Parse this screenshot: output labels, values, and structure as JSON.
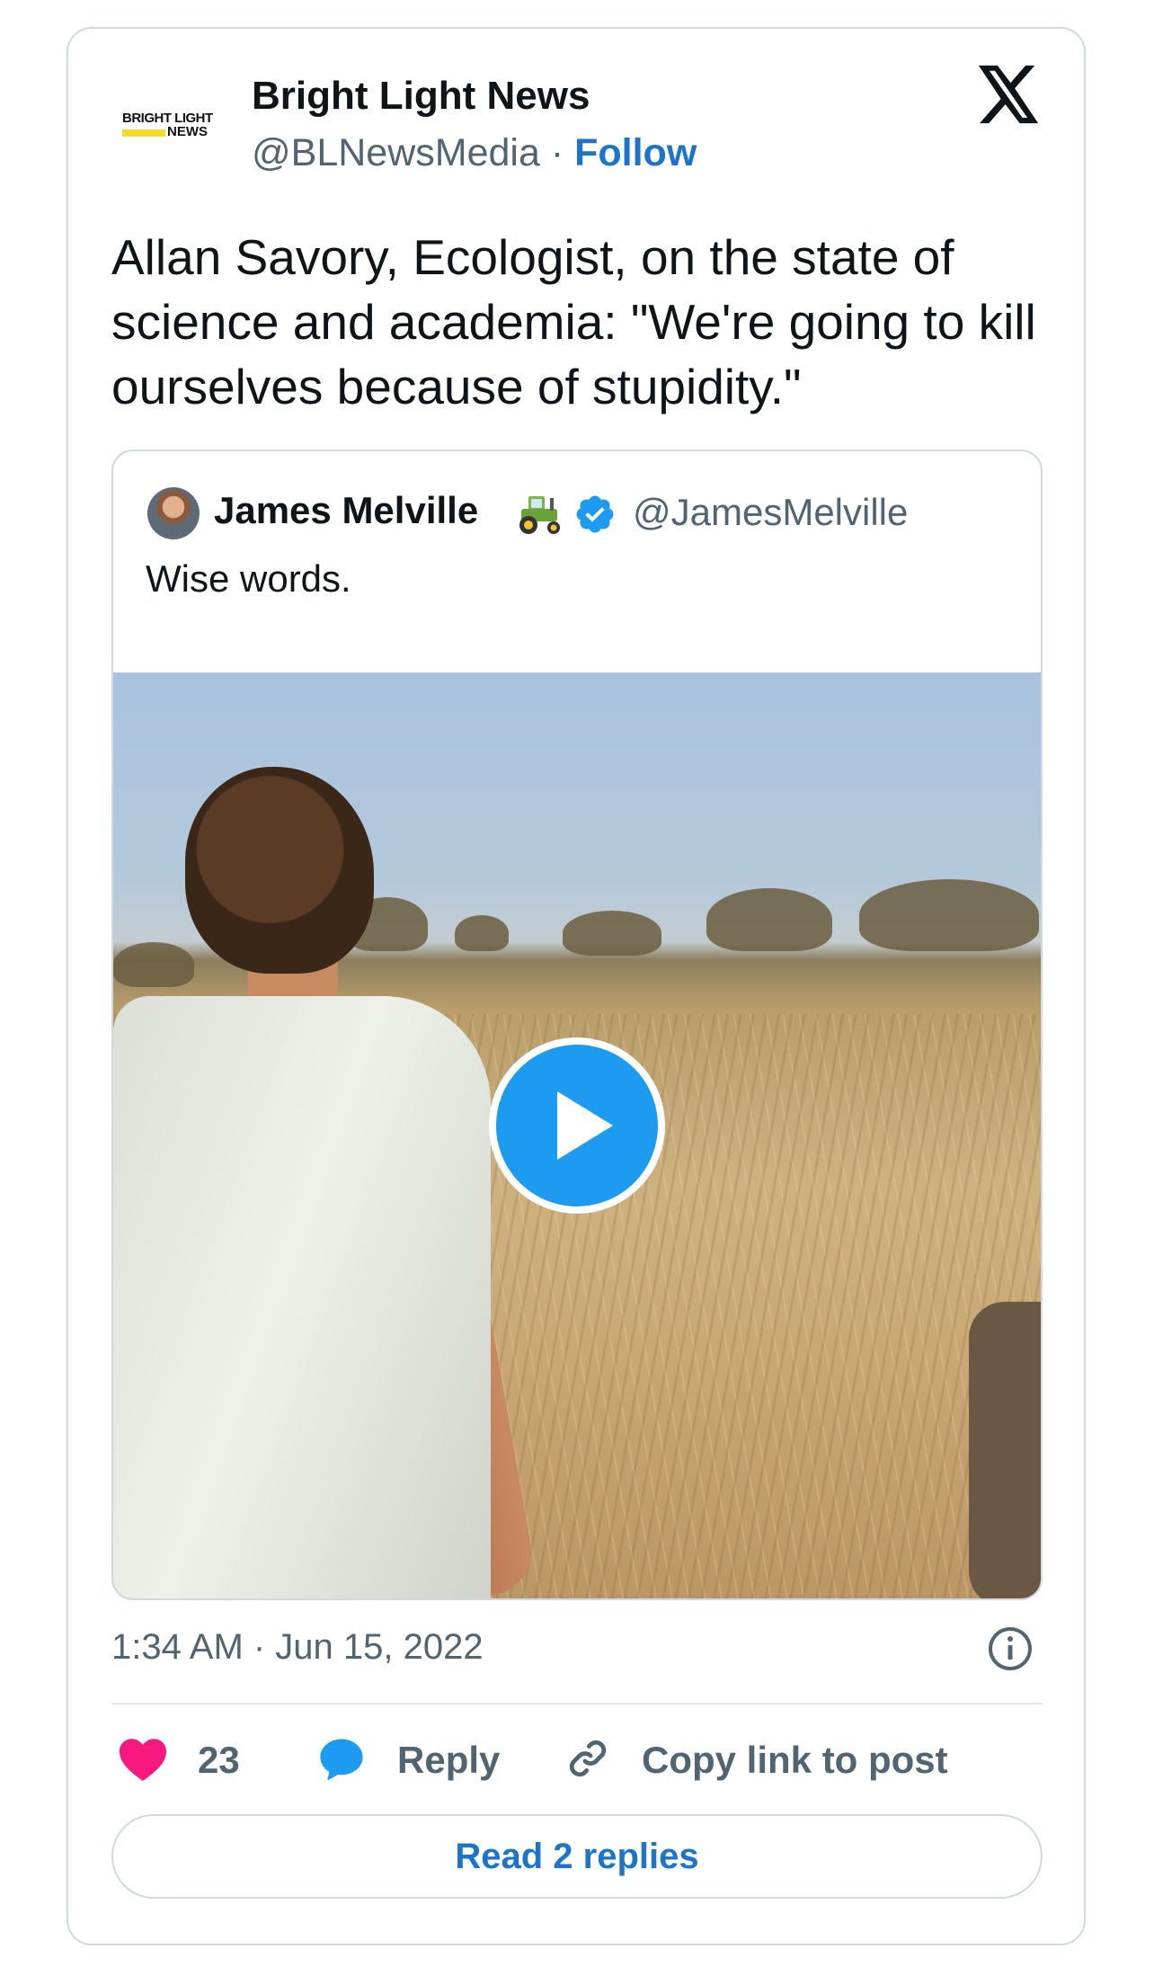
{
  "author": {
    "logo_text": "BRIGHT LIGHT",
    "logo_text2": "NEWS",
    "name": "Bright Light News",
    "handle": "@BLNewsMedia",
    "separator": "·",
    "follow_label": "Follow"
  },
  "tweet": {
    "text": "Allan Savory, Ecologist, on the state of science and academia: \"We're going to kill ourselves because of stupidity.\"",
    "timestamp": "1:34 AM · Jun 15, 2022"
  },
  "quoted": {
    "name": "James Melville",
    "handle": "@JamesMelville",
    "text": "Wise words."
  },
  "actions": {
    "likes_count": "23",
    "reply_label": "Reply",
    "copy_link_label": "Copy link to post",
    "read_replies_label": "Read 2 replies"
  },
  "icons": {
    "brand": "x-logo-icon",
    "play": "play-icon",
    "info": "info-icon",
    "like": "heart-icon",
    "reply": "speech-bubble-icon",
    "copy": "link-icon",
    "badge": "verified-badge-icon",
    "emoji": "tractor-icon"
  },
  "colors": {
    "accent": "#1d9bf0",
    "link": "#1d74c9",
    "heart": "#f91880",
    "muted": "#536471"
  }
}
